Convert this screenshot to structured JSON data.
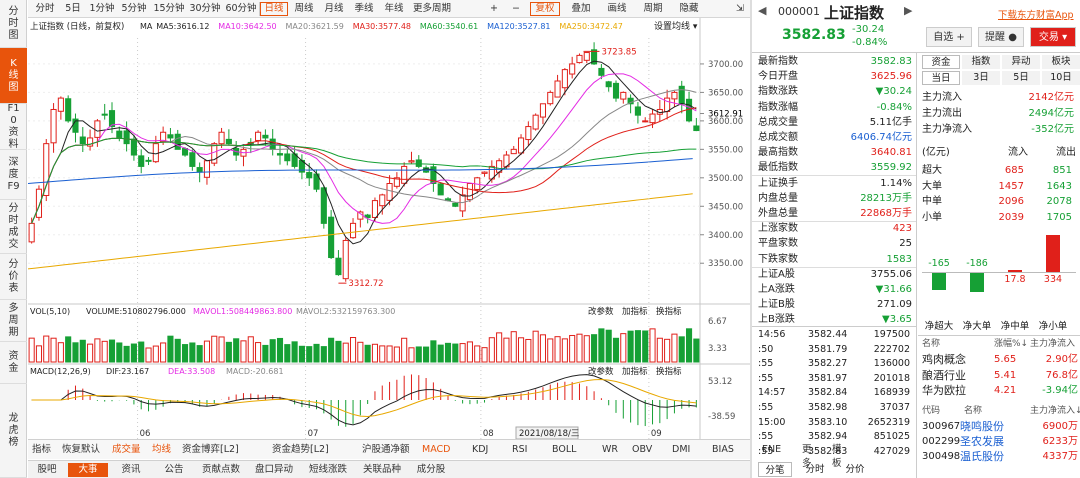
{
  "sidebar": [
    "分时图",
    "K线图",
    "F10资料",
    "深度F9",
    "分时成交",
    "分价表",
    "多周期",
    "资金",
    "龙虎榜"
  ],
  "sidebar_active": 1,
  "toolbar": {
    "periods": [
      "分时",
      "5日",
      "1分钟",
      "5分钟",
      "15分钟",
      "30分钟",
      "60分钟",
      "日线",
      "周线",
      "月线",
      "季线",
      "年线",
      "更多周期"
    ],
    "active": 7,
    "right": [
      "+",
      "−",
      "复权",
      "叠加",
      "画线",
      "周期",
      "隐藏"
    ],
    "right_active": 2
  },
  "chart_header": {
    "title": "上证指数 (日线，前复权)",
    "ma": [
      {
        "label": "MA",
        "value": "",
        "color": "#222"
      },
      {
        "label": "MA5:3616.12",
        "value": "",
        "color": "#222"
      },
      {
        "label": "MA10:3642.50",
        "value": "",
        "color": "#e42be4"
      },
      {
        "label": "MA20:3621.59",
        "value": "",
        "color": "#888"
      },
      {
        "label": "MA30:3577.48",
        "value": "",
        "color": "#e0201a"
      },
      {
        "label": "MA60:3540.61",
        "value": "",
        "color": "#16a035"
      },
      {
        "label": "MA120:3527.81",
        "value": "",
        "color": "#1a5fd1"
      },
      {
        "label": "MA250:3472.47",
        "value": "",
        "color": "#e8a800"
      }
    ],
    "settings": "设置均线"
  },
  "price_axis": [
    "3700.00",
    "3650.00",
    "3612.91",
    "3600.00",
    "3550.00",
    "3500.00",
    "3450.00",
    "3400.00",
    "3350.00"
  ],
  "annotations": {
    "high": "3723.85",
    "low": "3312.72"
  },
  "x_labels": [
    "06",
    "07",
    "08",
    "09"
  ],
  "date_tag": "2021/08/18/三",
  "vol_header": {
    "title": "VOL(5,10)",
    "volume": "VOLUME:510802796.000",
    "ma1": "MAVOL1:508449863.800",
    "ma2": "MAVOL2:532159763.300",
    "btns": [
      "改参数",
      "加指标",
      "换指标"
    ]
  },
  "vol_axis": [
    "6.67",
    "3.33"
  ],
  "macd_header": {
    "title": "MACD(12,26,9)",
    "dif": "DIF:23.167",
    "dea": "DEA:33.508",
    "macd": "MACD:-20.681",
    "btns": [
      "改参数",
      "加指标",
      "换指标"
    ]
  },
  "macd_axis": [
    "53.12",
    "-38.59"
  ],
  "indicator_tabs": [
    "指标",
    "恢复默认",
    "成交量",
    "均线",
    "资金博弈[L2]",
    "资金趋势[L2]",
    "沪股通净额",
    "MACD",
    "KDJ",
    "RSI",
    "BOLL",
    "WR",
    "OBV",
    "DMI",
    "BIAS",
    "ENE",
    "更多",
    "模板"
  ],
  "indicator_active": [
    2,
    3,
    7
  ],
  "bottom_tabs": [
    "股吧",
    "大事",
    "资讯",
    "公告",
    "贡献点数",
    "盘口异动",
    "短线涨跌",
    "关联品种",
    "成分股"
  ],
  "bottom_active": 1,
  "right": {
    "code": "000001",
    "name": "上证指数",
    "price": "3582.83",
    "change": "-30.24",
    "pct": "-0.84%",
    "download": "下载东方财富App",
    "buttons": [
      "自选",
      "提醒",
      "交易"
    ],
    "stats": [
      {
        "k": "最新指数",
        "v": "3582.83",
        "c": "grn"
      },
      {
        "k": "今日开盘",
        "v": "3625.96",
        "c": "red"
      },
      {
        "k": "指数涨跌",
        "v": "▼30.24",
        "c": "grn"
      },
      {
        "k": "指数涨幅",
        "v": "-0.84%",
        "c": "grn"
      },
      {
        "k": "总成交量",
        "v": "5.11亿手",
        "c": ""
      },
      {
        "k": "总成交额",
        "v": "6406.74亿元",
        "c": "blu"
      },
      {
        "k": "最高指数",
        "v": "3640.81",
        "c": "red"
      },
      {
        "k": "最低指数",
        "v": "3559.92",
        "c": "grn"
      },
      {
        "k": "上证换手",
        "v": "1.14%",
        "c": ""
      },
      {
        "k": "内盘总量",
        "v": "28213万手",
        "c": "grn"
      },
      {
        "k": "外盘总量",
        "v": "22868万手",
        "c": "red"
      },
      {
        "k": "上涨家数",
        "v": "423",
        "c": "red"
      },
      {
        "k": "平盘家数",
        "v": "25",
        "c": ""
      },
      {
        "k": "下跌家数",
        "v": "1583",
        "c": "grn"
      },
      {
        "k": "上证A股",
        "v": "3755.06",
        "c": ""
      },
      {
        "k": "上A涨跌",
        "v": "▼31.66",
        "c": "grn"
      },
      {
        "k": "上证B股",
        "v": "271.09",
        "c": ""
      },
      {
        "k": "上B涨跌",
        "v": "▼3.65",
        "c": "grn"
      }
    ],
    "ticks": [
      {
        "t": "14:56",
        "p": "3582.44",
        "v": "197500"
      },
      {
        "t": ":50",
        "p": "3581.79",
        "v": "222702"
      },
      {
        "t": ":55",
        "p": "3582.27",
        "v": "136000"
      },
      {
        "t": ":55",
        "p": "3581.97",
        "v": "201018"
      },
      {
        "t": "14:57",
        "p": "3582.84",
        "v": "168939"
      },
      {
        "t": ":55",
        "p": "3582.98",
        "v": "37037"
      },
      {
        "t": "15:00",
        "p": "3583.10",
        "v": "2652319"
      },
      {
        "t": ":55",
        "p": "3582.94",
        "v": "851025"
      },
      {
        "t": ":55",
        "p": "3582.83",
        "v": "427029"
      }
    ],
    "tick_tabs": [
      "分笔",
      "分时",
      "分价"
    ],
    "fund_tabs": [
      "资金",
      "指数",
      "异动",
      "板块"
    ],
    "period_tabs": [
      "当日",
      "3日",
      "5日",
      "10日"
    ],
    "flows": [
      {
        "k": "主力流入",
        "v": "2142亿元",
        "c": "red"
      },
      {
        "k": "主力流出",
        "v": "2494亿元",
        "c": "grn"
      },
      {
        "k": "主力净流入",
        "v": "-352亿元",
        "c": "grn"
      }
    ],
    "flow_table": {
      "head": [
        "(亿元)",
        "流入",
        "流出"
      ],
      "rows": [
        [
          "超大",
          "685",
          "851"
        ],
        [
          "大单",
          "1457",
          "1643"
        ],
        [
          "中单",
          "2096",
          "2078"
        ],
        [
          "小单",
          "2039",
          "1705"
        ]
      ]
    },
    "net_bars": [
      {
        "label": "净超大",
        "value": "-165",
        "v": -165
      },
      {
        "label": "净大单",
        "value": "-186",
        "v": -186
      },
      {
        "label": "净中单",
        "value": "17.8",
        "v": 17.8
      },
      {
        "label": "净小单",
        "value": "334",
        "v": 334
      }
    ],
    "sector_head": [
      "名称",
      "涨幅%",
      "主力净流入"
    ],
    "sectors": [
      {
        "n": "鸡肉概念",
        "p": "5.65",
        "f": "2.90亿"
      },
      {
        "n": "酿酒行业",
        "p": "5.41",
        "f": "76.8亿"
      },
      {
        "n": "华为欧拉",
        "p": "4.21",
        "f": "-3.94亿"
      }
    ],
    "stock_head": [
      "代码",
      "名称",
      "主力净流入"
    ],
    "stocks": [
      {
        "c": "300967",
        "n": "晓鸣股份",
        "f": "6900万"
      },
      {
        "c": "002299",
        "n": "圣农发展",
        "f": "6233万"
      },
      {
        "c": "300498",
        "n": "温氏股份",
        "f": "4337万"
      }
    ]
  }
}
